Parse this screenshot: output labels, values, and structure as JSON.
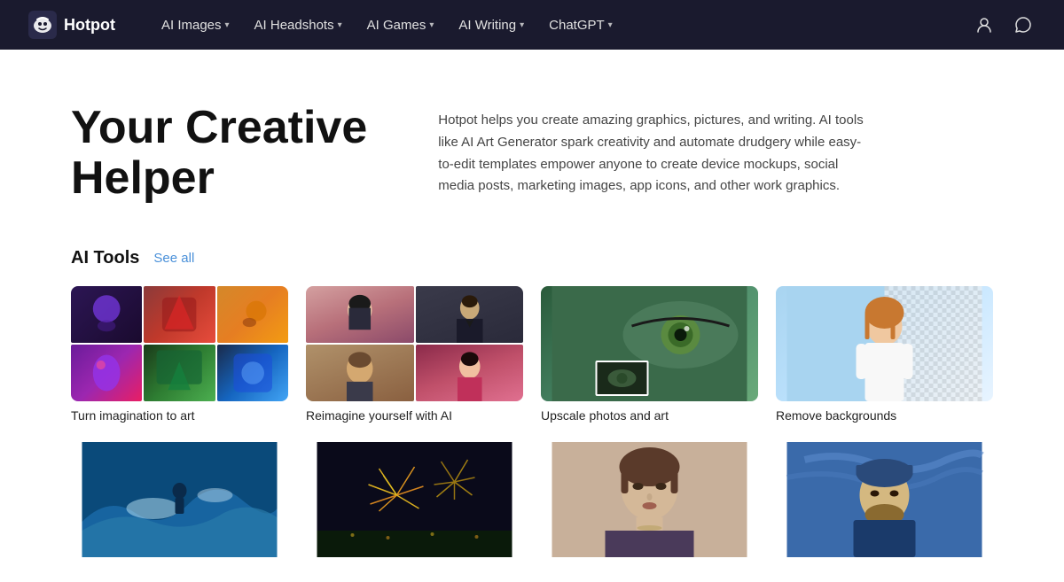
{
  "nav": {
    "logo_text": "Hotpot",
    "items": [
      {
        "id": "ai-images",
        "label": "AI Images",
        "has_dropdown": true
      },
      {
        "id": "ai-headshots",
        "label": "AI Headshots",
        "has_dropdown": true
      },
      {
        "id": "ai-games",
        "label": "AI Games",
        "has_dropdown": true
      },
      {
        "id": "ai-writing",
        "label": "AI Writing",
        "has_dropdown": true
      },
      {
        "id": "chatgpt",
        "label": "ChatGPT",
        "has_dropdown": true
      }
    ]
  },
  "hero": {
    "title_line1": "Your Creative",
    "title_line2": "Helper",
    "description": "Hotpot helps you create amazing graphics, pictures, and writing. AI tools like AI Art Generator spark creativity and automate drudgery while easy-to-edit templates empower anyone to create device mockups, social media posts, marketing images, app icons, and other work graphics."
  },
  "tools_section": {
    "heading": "AI Tools",
    "see_all_label": "See all",
    "cards": [
      {
        "id": "imagination-to-art",
        "label": "Turn imagination to art"
      },
      {
        "id": "reimagine-yourself",
        "label": "Reimagine yourself with AI"
      },
      {
        "id": "upscale-photos",
        "label": "Upscale photos and art"
      },
      {
        "id": "remove-backgrounds",
        "label": "Remove backgrounds"
      }
    ],
    "bottom_cards": [
      {
        "id": "card-b1",
        "label": ""
      },
      {
        "id": "card-b2",
        "label": ""
      },
      {
        "id": "card-b3",
        "label": ""
      },
      {
        "id": "card-b4",
        "label": ""
      }
    ]
  }
}
